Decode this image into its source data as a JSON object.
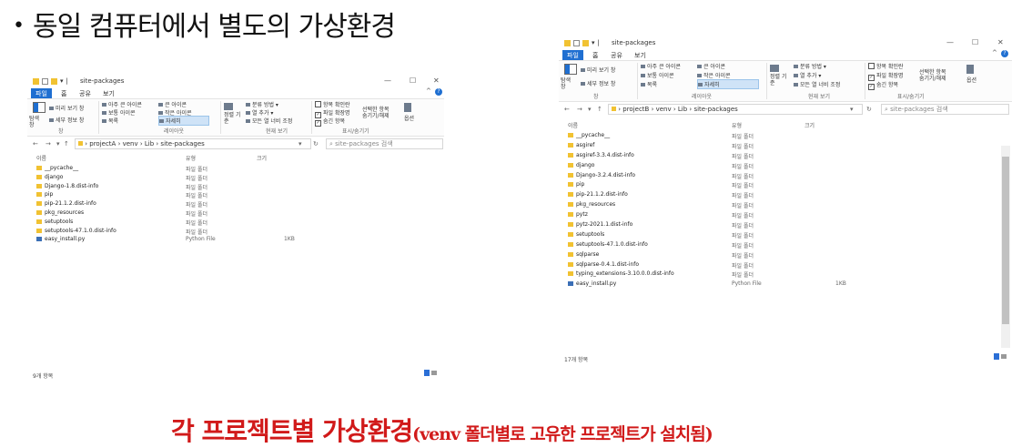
{
  "headline": "동일 컴퓨터에서 별도의 가상환경",
  "caption_main": "각 프로젝트별 가상환경",
  "caption_sub": "(venv 폴더별로 고유한 프로젝트가 설치됨)",
  "ribbon": {
    "tabs": [
      "파일",
      "홈",
      "공유",
      "보기"
    ],
    "preview_pane": "미리 보기 창",
    "details_pane": "세부 정보 창",
    "nav_pane": "탐색 창",
    "layout_items": [
      "아주 큰 아이콘",
      "큰 아이콘",
      "보통 아이콘",
      "작은 아이콘",
      "목록",
      "자세히"
    ],
    "sort_by": "정렬 기준",
    "group_by": "분류 방법",
    "add_columns": "열 추가",
    "fit_columns": "모든 열 너비 조정",
    "chk_item_checkbox": "항목 확인란",
    "chk_extensions": "파일 확장명",
    "chk_hidden": "숨긴 항목",
    "hide_selected": "선택한 항목 숨기기/해제",
    "options": "옵션",
    "group_pane": "창",
    "group_layout": "레이아웃",
    "group_current": "현재 보기",
    "group_showhide": "표시/숨기기"
  },
  "columns": {
    "name": "이름",
    "type": "유형",
    "size": "크기"
  },
  "window_a": {
    "title": "site-packages",
    "path": [
      "projectA",
      "venv",
      "Lib",
      "site-packages"
    ],
    "search": "site-packages 검색",
    "items": [
      {
        "name": "__pycache__",
        "type": "파일 폴더",
        "size": "",
        "kind": "folder"
      },
      {
        "name": "django",
        "type": "파일 폴더",
        "size": "",
        "kind": "folder"
      },
      {
        "name": "Django-1.8.dist-info",
        "type": "파일 폴더",
        "size": "",
        "kind": "folder"
      },
      {
        "name": "pip",
        "type": "파일 폴더",
        "size": "",
        "kind": "folder"
      },
      {
        "name": "pip-21.1.2.dist-info",
        "type": "파일 폴더",
        "size": "",
        "kind": "folder"
      },
      {
        "name": "pkg_resources",
        "type": "파일 폴더",
        "size": "",
        "kind": "folder"
      },
      {
        "name": "setuptools",
        "type": "파일 폴더",
        "size": "",
        "kind": "folder"
      },
      {
        "name": "setuptools-47.1.0.dist-info",
        "type": "파일 폴더",
        "size": "",
        "kind": "folder"
      },
      {
        "name": "easy_install.py",
        "type": "Python File",
        "size": "1KB",
        "kind": "file"
      }
    ],
    "status": "9개 항목"
  },
  "window_b": {
    "title": "site-packages",
    "path": [
      "projectB",
      "venv",
      "Lib",
      "site-packages"
    ],
    "search": "site-packages 검색",
    "items": [
      {
        "name": "__pycache__",
        "type": "파일 폴더",
        "size": "",
        "kind": "folder"
      },
      {
        "name": "asgiref",
        "type": "파일 폴더",
        "size": "",
        "kind": "folder"
      },
      {
        "name": "asgiref-3.3.4.dist-info",
        "type": "파일 폴더",
        "size": "",
        "kind": "folder"
      },
      {
        "name": "django",
        "type": "파일 폴더",
        "size": "",
        "kind": "folder"
      },
      {
        "name": "Django-3.2.4.dist-info",
        "type": "파일 폴더",
        "size": "",
        "kind": "folder"
      },
      {
        "name": "pip",
        "type": "파일 폴더",
        "size": "",
        "kind": "folder"
      },
      {
        "name": "pip-21.1.2.dist-info",
        "type": "파일 폴더",
        "size": "",
        "kind": "folder"
      },
      {
        "name": "pkg_resources",
        "type": "파일 폴더",
        "size": "",
        "kind": "folder"
      },
      {
        "name": "pytz",
        "type": "파일 폴더",
        "size": "",
        "kind": "folder"
      },
      {
        "name": "pytz-2021.1.dist-info",
        "type": "파일 폴더",
        "size": "",
        "kind": "folder"
      },
      {
        "name": "setuptools",
        "type": "파일 폴더",
        "size": "",
        "kind": "folder"
      },
      {
        "name": "setuptools-47.1.0.dist-info",
        "type": "파일 폴더",
        "size": "",
        "kind": "folder"
      },
      {
        "name": "sqlparse",
        "type": "파일 폴더",
        "size": "",
        "kind": "folder"
      },
      {
        "name": "sqlparse-0.4.1.dist-info",
        "type": "파일 폴더",
        "size": "",
        "kind": "folder"
      },
      {
        "name": "typing_extensions-3.10.0.0.dist-info",
        "type": "파일 폴더",
        "size": "",
        "kind": "folder"
      },
      {
        "name": "easy_install.py",
        "type": "Python File",
        "size": "1KB",
        "kind": "file"
      }
    ],
    "status": "17개 항목"
  },
  "colors": {
    "accent": "#1f6fd1",
    "folder": "#f1c232",
    "caption": "#d11a1a"
  }
}
